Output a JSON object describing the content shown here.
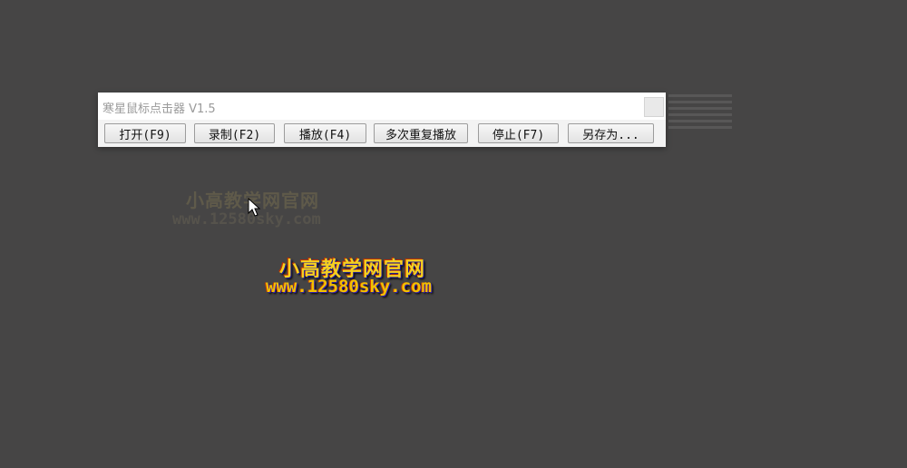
{
  "window": {
    "title": "寒星鼠标点击器 V1.5"
  },
  "toolbar": {
    "buttons": [
      {
        "label": "打开(F9)"
      },
      {
        "label": "录制(F2)"
      },
      {
        "label": "播放(F4)"
      },
      {
        "label": "多次重复播放"
      },
      {
        "label": "停止(F7)"
      },
      {
        "label": "另存为..."
      }
    ]
  },
  "watermarks": [
    {
      "title": "小高教学网官网",
      "url": "www.12580sky.com"
    },
    {
      "title": "小高教学网官网",
      "url": "www.12580sky.com"
    }
  ],
  "icons": {
    "cursor": "mouse-pointer-icon"
  }
}
